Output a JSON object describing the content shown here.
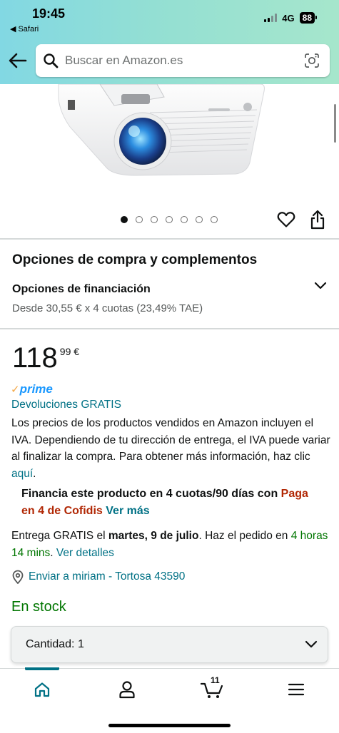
{
  "status_bar": {
    "time": "19:45",
    "back_app": "Safari",
    "network": "4G",
    "battery": "88"
  },
  "search": {
    "placeholder": "Buscar en Amazon.es"
  },
  "gallery": {
    "image_count": 7,
    "active_index": 0
  },
  "purchase_options": {
    "title": "Opciones de compra y complementos",
    "financing_title": "Opciones de financiación",
    "financing_detail": "Desde 30,55 € x 4 cuotas (23,49% TAE)"
  },
  "price": {
    "whole": "118",
    "fraction": "99 €"
  },
  "prime": {
    "check": "✓",
    "label": "prime"
  },
  "returns_label": "Devoluciones GRATIS",
  "vat_notice": {
    "text": "Los precios de los productos vendidos en Amazon incluyen el IVA. Dependiendo de tu dirección de entrega, el IVA puede variar al finalizar la compra. Para obtener más información, haz clic ",
    "link": "aquí",
    "end": "."
  },
  "financing_promo": {
    "text": "Financia este producto en 4 cuotas/90 días con ",
    "provider": "Paga en 4 de Cofidis",
    "link": "Ver más"
  },
  "delivery": {
    "prefix": "Entrega GRATIS el ",
    "date": "martes, 9 de julio",
    "middle": ". Haz el pedido en ",
    "countdown": "4 horas 14 mins",
    "sep": ". ",
    "details_link": "Ver detalles"
  },
  "ship_to": "Enviar a miriam - Tortosa 43590",
  "stock_status": "En stock",
  "quantity": {
    "label": "Cantidad:",
    "value": "1"
  },
  "bottom_nav": {
    "cart_count": "11",
    "items": [
      "home-icon",
      "account-icon",
      "cart-icon",
      "menu-icon"
    ]
  },
  "colors": {
    "link": "#007185",
    "price_text": "#0f1111",
    "stock_green": "#007600",
    "cofidis_red": "#b12704",
    "prime_blue": "#1a98ff",
    "prime_orange": "#f3a847",
    "header_gradient": [
      "#82d8e3",
      "#a6e6cc"
    ]
  }
}
